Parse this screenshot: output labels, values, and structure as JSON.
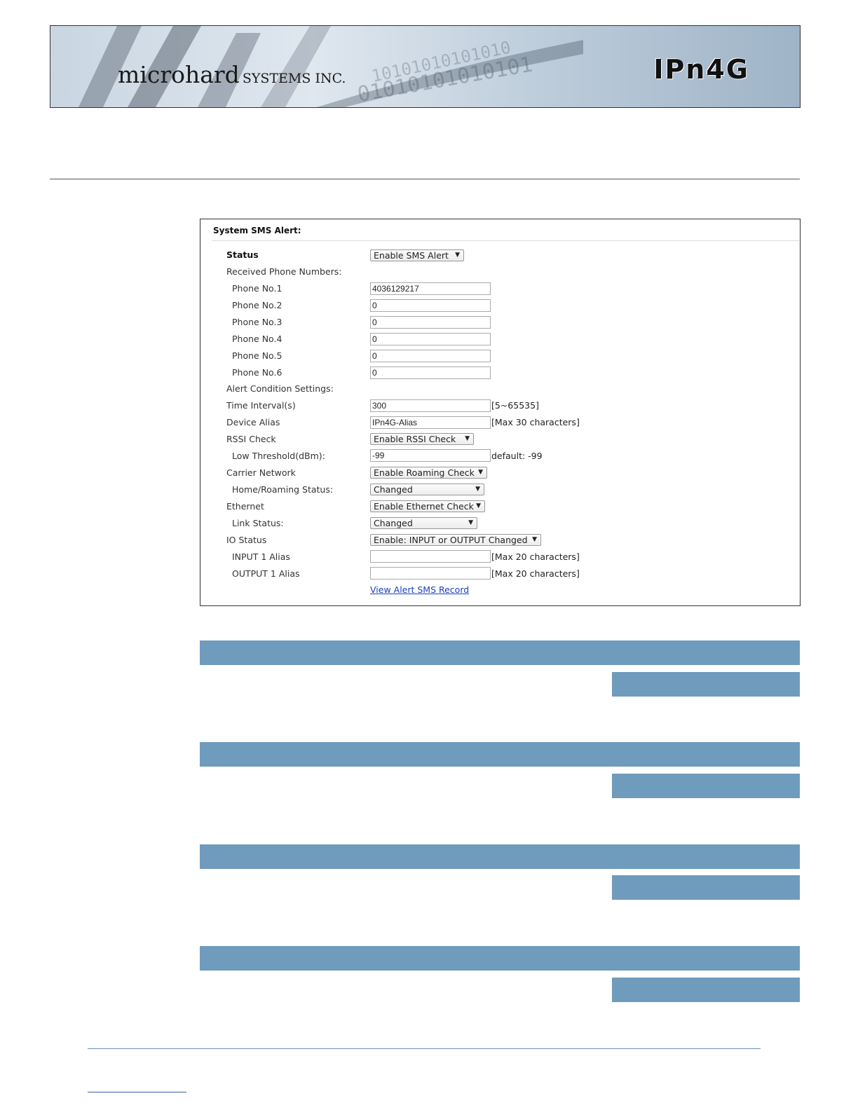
{
  "header": {
    "company": "microhard",
    "company_sub": "SYSTEMS INC.",
    "product": "IPn4G"
  },
  "panel": {
    "title": "System SMS Alert:",
    "status": {
      "label": "Status",
      "value": "Enable SMS Alert"
    },
    "received_heading": "Received Phone Numbers:",
    "phones": [
      {
        "label": "Phone No.1",
        "value": "4036129217"
      },
      {
        "label": "Phone No.2",
        "value": "0"
      },
      {
        "label": "Phone No.3",
        "value": "0"
      },
      {
        "label": "Phone No.4",
        "value": "0"
      },
      {
        "label": "Phone No.5",
        "value": "0"
      },
      {
        "label": "Phone No.6",
        "value": "0"
      }
    ],
    "alert_heading": "Alert Condition Settings:",
    "time_interval": {
      "label": "Time Interval(s)",
      "value": "300",
      "hint": "[5~65535]"
    },
    "device_alias": {
      "label": "Device Alias",
      "value": "IPn4G-Alias",
      "hint": "[Max 30 characters]"
    },
    "rssi_check": {
      "label": "RSSI Check",
      "value": "Enable RSSI Check"
    },
    "low_threshold": {
      "label": "Low Threshold(dBm):",
      "value": "-99",
      "hint": "default: -99"
    },
    "carrier_network": {
      "label": "Carrier Network",
      "value": "Enable Roaming Check"
    },
    "home_roaming": {
      "label": "Home/Roaming Status:",
      "value": "Changed"
    },
    "ethernet": {
      "label": "Ethernet",
      "value": "Enable Ethernet Check"
    },
    "link_status": {
      "label": "Link Status:",
      "value": "Changed"
    },
    "io_status": {
      "label": "IO Status",
      "value": "Enable: INPUT or OUTPUT Changed"
    },
    "input_alias": {
      "label": "INPUT 1 Alias",
      "value": "",
      "hint": "[Max 20 characters]"
    },
    "output_alias": {
      "label": "OUTPUT 1 Alias",
      "value": "",
      "hint": "[Max 20 characters]"
    },
    "view_record_link": "View Alert SMS Record"
  },
  "colors": {
    "bar": "#6f9bbd",
    "link": "#1a3fbf"
  },
  "icons": {
    "dropdown": "chevron-down-icon"
  }
}
